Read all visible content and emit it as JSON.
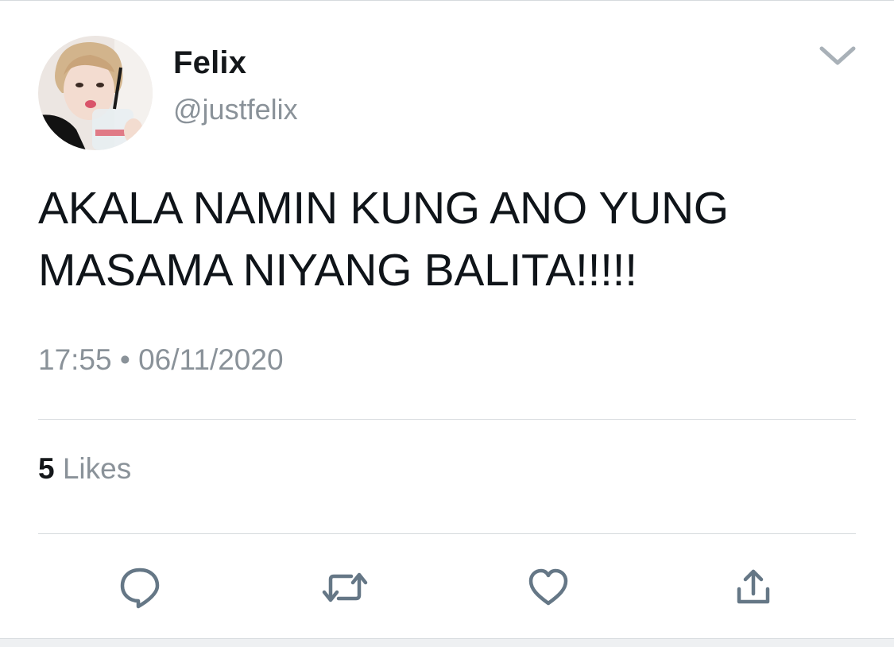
{
  "tweet": {
    "author": {
      "display_name": "Felix",
      "handle": "@justfelix",
      "avatar_icon": "profile-photo"
    },
    "text_lines": [
      "AKALA NAMIN KUNG ANO YUNG",
      "MASAMA NIYANG BALITA!!!!!"
    ],
    "timestamp": "17:55 • 06/11/2020",
    "likes": {
      "count": "5",
      "label": "Likes"
    },
    "actions": [
      {
        "name": "reply",
        "icon": "speech-bubble-icon"
      },
      {
        "name": "retweet",
        "icon": "retweet-arrows-icon"
      },
      {
        "name": "like",
        "icon": "heart-icon"
      },
      {
        "name": "share",
        "icon": "share-upload-icon"
      }
    ],
    "menu_icon": "chevron-down-icon"
  },
  "colors": {
    "primary_text": "#14171a",
    "secondary_text": "#8a9299",
    "icon": "#657786",
    "divider": "#d6dadd"
  }
}
